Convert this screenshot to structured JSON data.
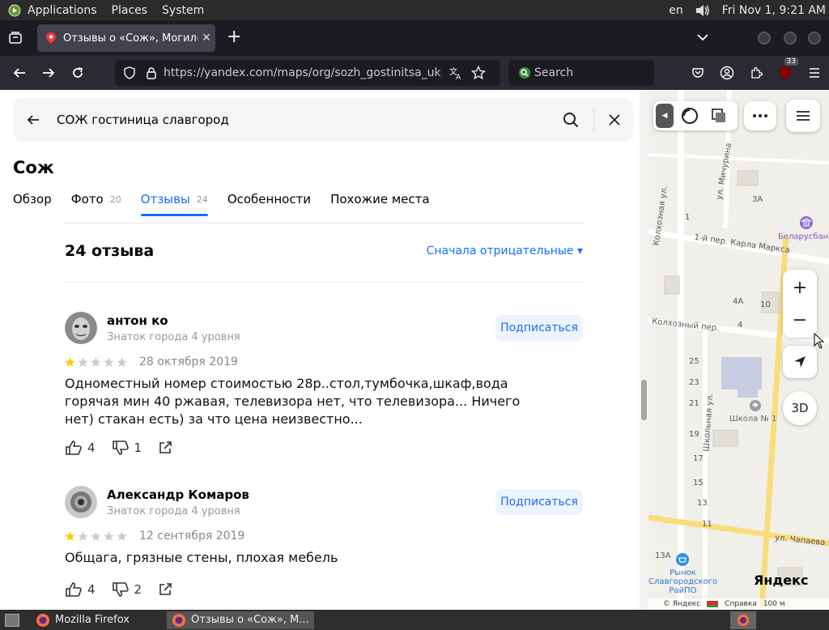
{
  "system_bar": {
    "menus": [
      "Applications",
      "Places",
      "System"
    ],
    "lang": "en",
    "clock": "Fri Nov 1,  9:21 AM"
  },
  "browser": {
    "tab_title": "Отзывы о «Сож», Могилёв",
    "url": "https://yandex.com/maps/org/sozh_gostinitsa_ukp_zhilk",
    "search_placeholder": "Search",
    "badge_count": "33"
  },
  "maps_panel": {
    "search_query": "СОЖ гостиница славгород",
    "org_name": "Сож",
    "tabs": [
      {
        "label": "Обзор",
        "count": ""
      },
      {
        "label": "Фото",
        "count": "20"
      },
      {
        "label": "Отзывы",
        "count": "24"
      },
      {
        "label": "Особенности",
        "count": ""
      },
      {
        "label": "Похожие места",
        "count": ""
      }
    ],
    "reviews_count_label": "24 отзыва",
    "sort_label": "Сначала отрицательные ▾",
    "subscribe_label": "Подписаться",
    "reviews": [
      {
        "author": "антон ко",
        "level": "Знаток города 4 уровня",
        "rating": 1,
        "date": "28 октября 2019",
        "text": "Одноместный номер стоимостью 28р..стол,тумбочка,шкаф,вода горячая мин 40 ржавая, телевизора нет, что телевизора... Ничего нет) стакан есть) за что цена неизвестно...",
        "likes": "4",
        "dislikes": "1"
      },
      {
        "author": "Александр Комаров",
        "level": "Знаток города 4 уровня",
        "rating": 1,
        "date": "12 сентября 2019",
        "text": "Общага, грязные стены, плохая мебель",
        "likes": "4",
        "dislikes": "2"
      }
    ]
  },
  "map": {
    "streets": {
      "kolkhoznaya": "Колхозная ул.",
      "michurina": "ул. Мичурина",
      "karla_marksa": "1-й пер. Карла Маркса",
      "kolkhozny_per": "Колхозный пер.",
      "shkolnaya": "Школьная ул.",
      "chapaeva": "ул. Чапаева"
    },
    "places": {
      "bank": "Беларусбан",
      "school": "Школа № 1",
      "market": "Рынок Славгородского РайПО"
    },
    "house_numbers": [
      "3А",
      "1",
      "10",
      "4А",
      "4",
      "23",
      "25",
      "21",
      "19",
      "17",
      "15",
      "13",
      "11",
      "13А"
    ],
    "zoom_in": "+",
    "zoom_out": "−",
    "mode_3d": "3D",
    "logo": "Яндекс",
    "copyright": "© Яндекс",
    "help": "Справка",
    "scale": "100 м"
  },
  "taskbar": {
    "items": [
      "Mozilla Firefox",
      "Отзывы о «Сож», М..."
    ]
  },
  "colors": {
    "accent": "#196dff",
    "star_filled": "#fc0",
    "star_empty": "#ccc"
  }
}
